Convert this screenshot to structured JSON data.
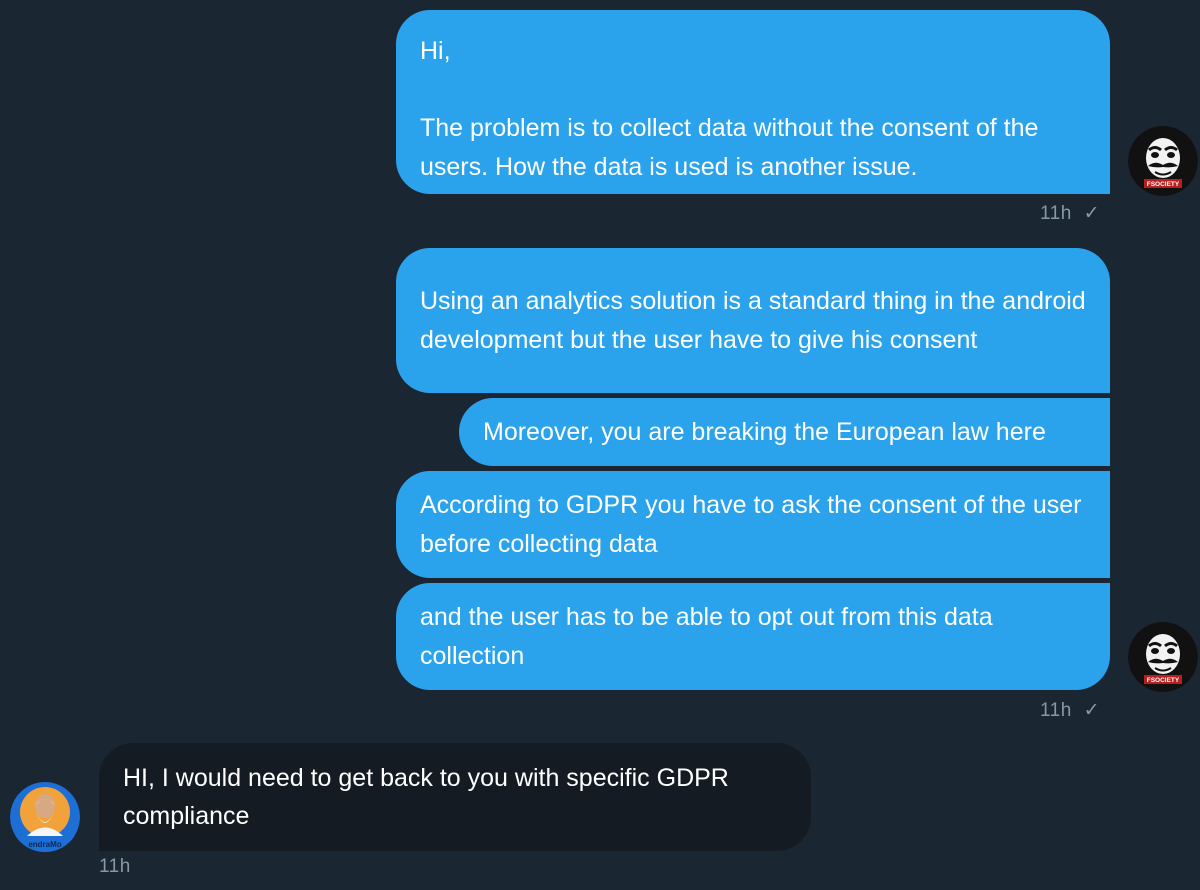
{
  "conversation": {
    "messages": [
      {
        "id": "m1",
        "direction": "sent",
        "text": "Hi,\n\nThe problem is to collect data without the consent of the users. How the data is used is another issue."
      },
      {
        "id": "m2",
        "direction": "sent",
        "text": "Using an analytics solution is a standard thing in the android development but the user have to give his consent"
      },
      {
        "id": "m3",
        "direction": "sent",
        "text": "Moreover, you are breaking the European law here"
      },
      {
        "id": "m4",
        "direction": "sent",
        "text": "According to GDPR you have to ask the consent of the user before collecting data"
      },
      {
        "id": "m5",
        "direction": "sent",
        "text": "and the user has to be able to opt out from this data collection"
      },
      {
        "id": "m6",
        "direction": "received",
        "text": "HI, I would need to get back to you with specific GDPR compliance"
      }
    ],
    "timestamps": {
      "group1": "11h",
      "group2": "11h",
      "received": "11h"
    },
    "read_receipt_icon": "checkmark-icon",
    "sender_avatar": {
      "icon": "fsociety-mask-icon",
      "badge_text": "FSOCIETY"
    },
    "recipient_avatar": {
      "icon": "profile-photo",
      "name_fragment": "endraMo"
    },
    "colors": {
      "background": "#1b2633",
      "sent_bubble": "#2aa3ec",
      "received_bubble": "#141b23",
      "meta_text": "#8899a6"
    }
  }
}
